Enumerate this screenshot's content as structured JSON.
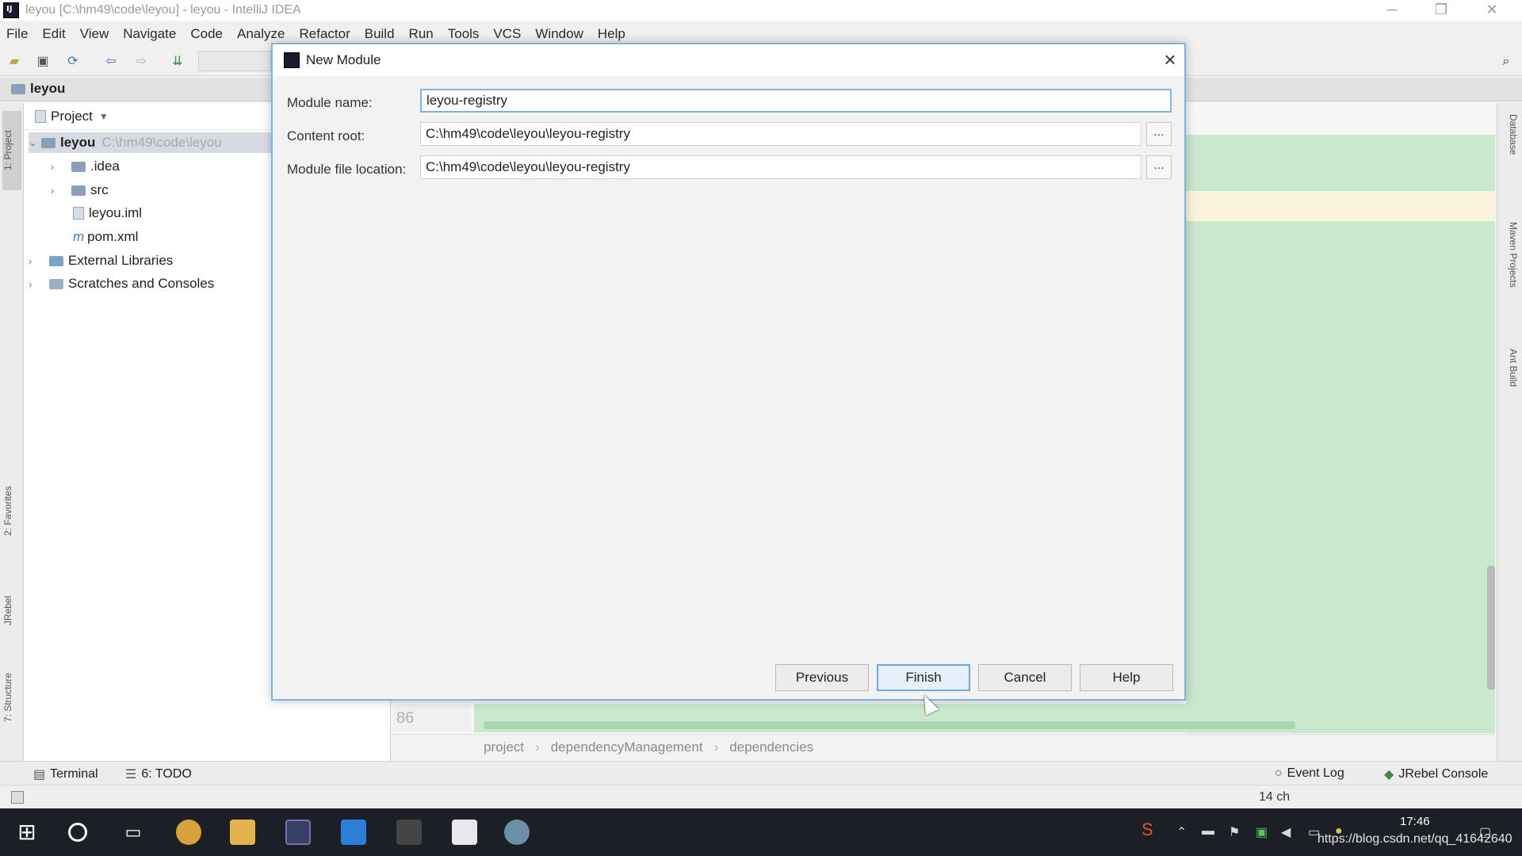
{
  "window": {
    "title": "leyou [C:\\hm49\\code\\leyou] - leyou - IntelliJ IDEA"
  },
  "menu": [
    "File",
    "Edit",
    "View",
    "Navigate",
    "Code",
    "Analyze",
    "Refactor",
    "Build",
    "Run",
    "Tools",
    "VCS",
    "Window",
    "Help"
  ],
  "navbar": {
    "project": "leyou"
  },
  "left_stripe": {
    "project_tab": "1: Project",
    "favorites_tab": "2: Favorites",
    "jrebel_tab": "JRebel",
    "structure_tab": "7: Structure"
  },
  "project_panel": {
    "header": "Project",
    "tree": [
      {
        "label": "leyou",
        "path": "C:\\hm49\\code\\leyou"
      },
      {
        "label": ".idea"
      },
      {
        "label": "src"
      },
      {
        "label": "leyou.iml"
      },
      {
        "label": "pom.xml"
      },
      {
        "label": "External Libraries"
      },
      {
        "label": "Scratches and Consoles"
      }
    ]
  },
  "editor": {
    "line_number": "86",
    "breadcrumbs": [
      "project",
      "dependencyManagement",
      "dependencies"
    ]
  },
  "right_stripe": {
    "database_tab": "Database",
    "maven_tab": "Maven Projects",
    "ant_tab": "Ant Build"
  },
  "bottom_tools": {
    "terminal": "Terminal",
    "todo": "6: TODO",
    "event_log": "Event Log",
    "jrebel_console": "JRebel Console"
  },
  "status": {
    "chars": "14 ch"
  },
  "taskbar": {
    "time": "17:46",
    "watermark": "https://blog.csdn.net/qq_41642640"
  },
  "dialog": {
    "title": "New Module",
    "module_name_label": "Module name:",
    "module_name_value": "leyou-registry",
    "content_root_label": "Content root:",
    "content_root_value": "C:\\hm49\\code\\leyou\\leyou-registry",
    "module_file_label": "Module file location:",
    "module_file_value": "C:\\hm49\\code\\leyou\\leyou-registry",
    "browse": "...",
    "buttons": {
      "previous": "Previous",
      "finish": "Finish",
      "cancel": "Cancel",
      "help": "Help"
    }
  },
  "colors": {
    "dialog_border": "#7fb3e3",
    "editor_added": "#c9e8cd",
    "editor_current_line": "#fbf4dd",
    "taskbar": "#1c1f26"
  }
}
